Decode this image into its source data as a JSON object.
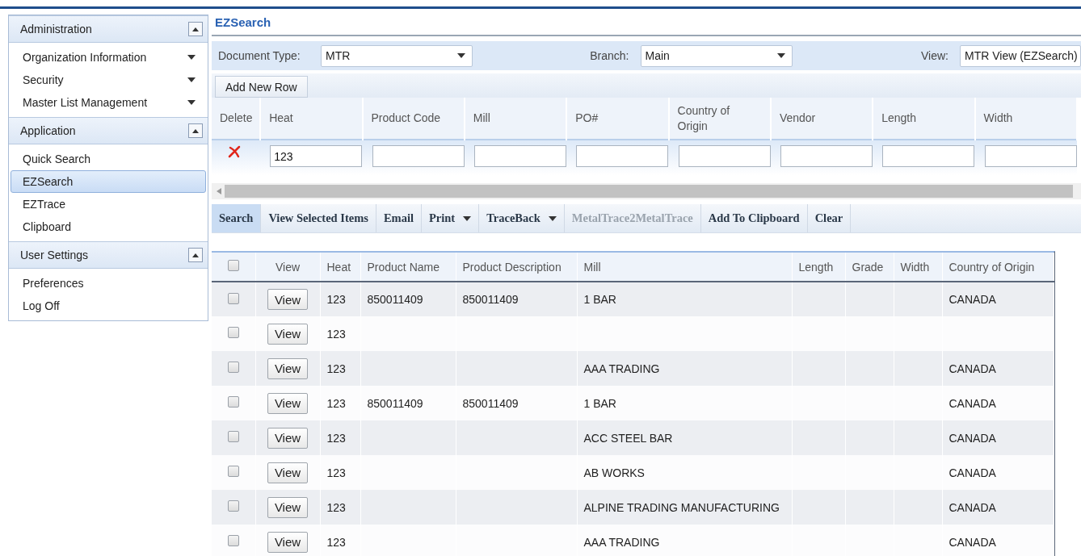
{
  "sidebar": {
    "sections": [
      {
        "title": "Administration",
        "expanded": true,
        "items": [
          {
            "label": "Organization Information",
            "kind": "submenu",
            "selected": false
          },
          {
            "label": "Security",
            "kind": "submenu",
            "selected": false
          },
          {
            "label": "Master List Management",
            "kind": "submenu",
            "selected": false
          }
        ]
      },
      {
        "title": "Application",
        "expanded": true,
        "items": [
          {
            "label": "Quick Search",
            "kind": "link",
            "selected": false
          },
          {
            "label": "EZSearch",
            "kind": "link",
            "selected": true
          },
          {
            "label": "EZTrace",
            "kind": "link",
            "selected": false
          },
          {
            "label": "Clipboard",
            "kind": "link",
            "selected": false
          }
        ]
      },
      {
        "title": "User Settings",
        "expanded": true,
        "items": [
          {
            "label": "Preferences",
            "kind": "link",
            "selected": false
          },
          {
            "label": "Log Off",
            "kind": "link",
            "selected": false
          }
        ]
      }
    ]
  },
  "page_title": "EZSearch",
  "filters": [
    {
      "label": "Document Type:",
      "value": "MTR"
    },
    {
      "label": "Branch:",
      "value": "Main"
    },
    {
      "label": "View:",
      "value": "MTR View (EZSearch)"
    }
  ],
  "add_row_button": "Add New Row",
  "criteria": {
    "delete_label": "Delete",
    "columns": [
      {
        "label": "Heat",
        "value": "123"
      },
      {
        "label": "Product Code"
      },
      {
        "label": "Mill"
      },
      {
        "label": "PO#"
      },
      {
        "label": "Country of Origin"
      },
      {
        "label": "Vendor"
      },
      {
        "label": "Length"
      },
      {
        "label": "Width"
      }
    ]
  },
  "actions": [
    {
      "label": "Search",
      "kind": "button",
      "selected": true,
      "disabled": false
    },
    {
      "label": "View Selected Items",
      "kind": "button",
      "selected": false,
      "disabled": false
    },
    {
      "label": "Email",
      "kind": "button",
      "selected": false,
      "disabled": false
    },
    {
      "label": "Print",
      "kind": "dropdown",
      "selected": false,
      "disabled": false
    },
    {
      "label": "TraceBack",
      "kind": "dropdown",
      "selected": false,
      "disabled": false
    },
    {
      "label": "MetalTrace2MetalTrace",
      "kind": "button",
      "selected": false,
      "disabled": true
    },
    {
      "label": "Add To Clipboard",
      "kind": "button",
      "selected": false,
      "disabled": false
    },
    {
      "label": "Clear",
      "kind": "button",
      "selected": false,
      "disabled": false
    }
  ],
  "results": {
    "select_all_checked": false,
    "columns": [
      "View",
      "Heat",
      "Product Name",
      "Product Description",
      "Mill",
      "Length",
      "Grade",
      "Width",
      "Country of Origin"
    ],
    "rows": [
      {
        "checked": false,
        "cells": [
          "View",
          "123",
          "850011409",
          "850011409",
          "1 BAR",
          null,
          null,
          null,
          "CANADA"
        ]
      },
      {
        "checked": false,
        "cells": [
          "View",
          "123",
          null,
          null,
          null,
          null,
          null,
          null,
          null
        ]
      },
      {
        "checked": false,
        "cells": [
          "View",
          "123",
          null,
          null,
          "AAA TRADING",
          null,
          null,
          null,
          "CANADA"
        ]
      },
      {
        "checked": false,
        "cells": [
          "View",
          "123",
          "850011409",
          "850011409",
          "1 BAR",
          null,
          null,
          null,
          "CANADA"
        ]
      },
      {
        "checked": false,
        "cells": [
          "View",
          "123",
          null,
          null,
          "ACC STEEL BAR",
          null,
          null,
          null,
          "CANADA"
        ]
      },
      {
        "checked": false,
        "cells": [
          "View",
          "123",
          null,
          null,
          "AB WORKS",
          null,
          null,
          null,
          "CANADA"
        ]
      },
      {
        "checked": false,
        "cells": [
          "View",
          "123",
          null,
          null,
          "ALPINE TRADING MANUFACTURING",
          null,
          null,
          null,
          "CANADA"
        ]
      },
      {
        "checked": false,
        "cells": [
          "View",
          "123",
          null,
          null,
          "AAA TRADING",
          null,
          null,
          null,
          "CANADA"
        ]
      }
    ]
  }
}
